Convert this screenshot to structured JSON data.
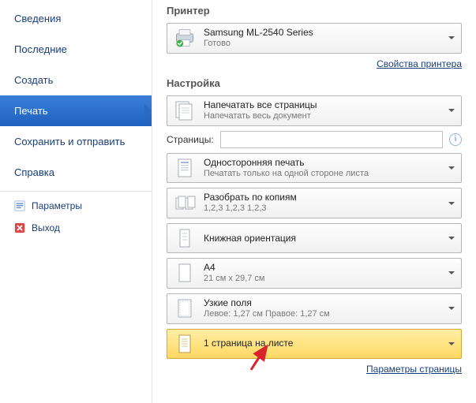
{
  "sidebar": {
    "items": [
      {
        "label": "Сведения"
      },
      {
        "label": "Последние"
      },
      {
        "label": "Создать"
      },
      {
        "label": "Печать"
      },
      {
        "label": "Сохранить и отправить"
      },
      {
        "label": "Справка"
      },
      {
        "label": "Параметры"
      },
      {
        "label": "Выход"
      }
    ]
  },
  "printer": {
    "section": "Принтер",
    "name": "Samsung ML-2540 Series",
    "status": "Готово",
    "properties_link": "Свойства принтера"
  },
  "settings": {
    "section": "Настройка",
    "print_all": {
      "t1": "Напечатать все страницы",
      "t2": "Напечатать весь документ"
    },
    "pages_label": "Страницы:",
    "pages_value": "",
    "one_side": {
      "t1": "Односторонняя печать",
      "t2": "Печатать только на одной стороне листа"
    },
    "collate": {
      "t1": "Разобрать по копиям",
      "t2": "1,2,3   1,2,3   1,2,3"
    },
    "orientation": {
      "t1": "Книжная ориентация"
    },
    "paper": {
      "t1": "A4",
      "t2": "21 см x 29,7 см"
    },
    "margins": {
      "t1": "Узкие поля",
      "t2": "Левое: 1,27 см    Правое: 1,27 см"
    },
    "per_sheet": {
      "t1": "1 страница на листе"
    },
    "page_setup_link": "Параметры страницы"
  }
}
